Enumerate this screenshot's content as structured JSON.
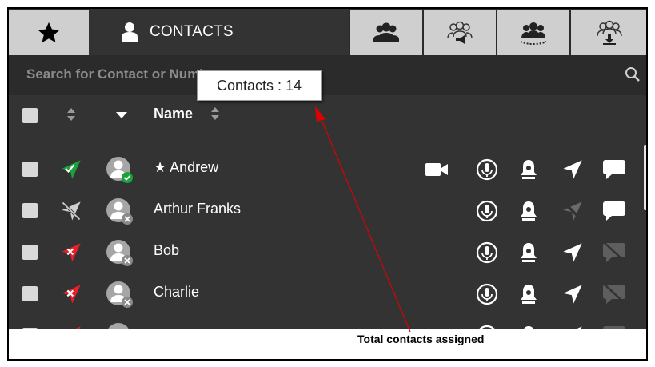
{
  "tabs": {
    "favorites_icon": "star-icon",
    "contacts_label": "CONTACTS",
    "contacts_icon": "person-icon",
    "other_icons": [
      "group-icon",
      "broadcast-group-icon",
      "conference-icon",
      "download-group-icon"
    ]
  },
  "search": {
    "placeholder": "Search for Contact or Number",
    "icon": "search-icon"
  },
  "tooltip": {
    "text": "Contacts : 14"
  },
  "table": {
    "name_header": "Name",
    "rows": [
      {
        "name": "★ Andrew",
        "status": "online",
        "icons": [
          "video-icon",
          "ptt-icon",
          "alert-icon",
          "location-icon",
          "message-icon"
        ]
      },
      {
        "name": "Arthur Franks",
        "status": "disabled",
        "icons": [
          "ptt-icon",
          "alert-icon",
          "location-disabled-icon",
          "message-icon"
        ]
      },
      {
        "name": "Bob",
        "status": "offline",
        "icons": [
          "ptt-icon",
          "alert-icon",
          "location-icon",
          "message-disabled-icon"
        ]
      },
      {
        "name": "Charlie",
        "status": "offline",
        "icons": [
          "ptt-icon",
          "alert-icon",
          "location-icon",
          "message-disabled-icon"
        ]
      }
    ]
  },
  "annotation": {
    "text": "Total contacts assigned",
    "color": "#e00000"
  },
  "colors": {
    "background": "#333333",
    "header": "#2b2b2b",
    "tab_inactive": "#cfcfcf",
    "online": "#1aa33c",
    "offline": "#e8202a"
  }
}
